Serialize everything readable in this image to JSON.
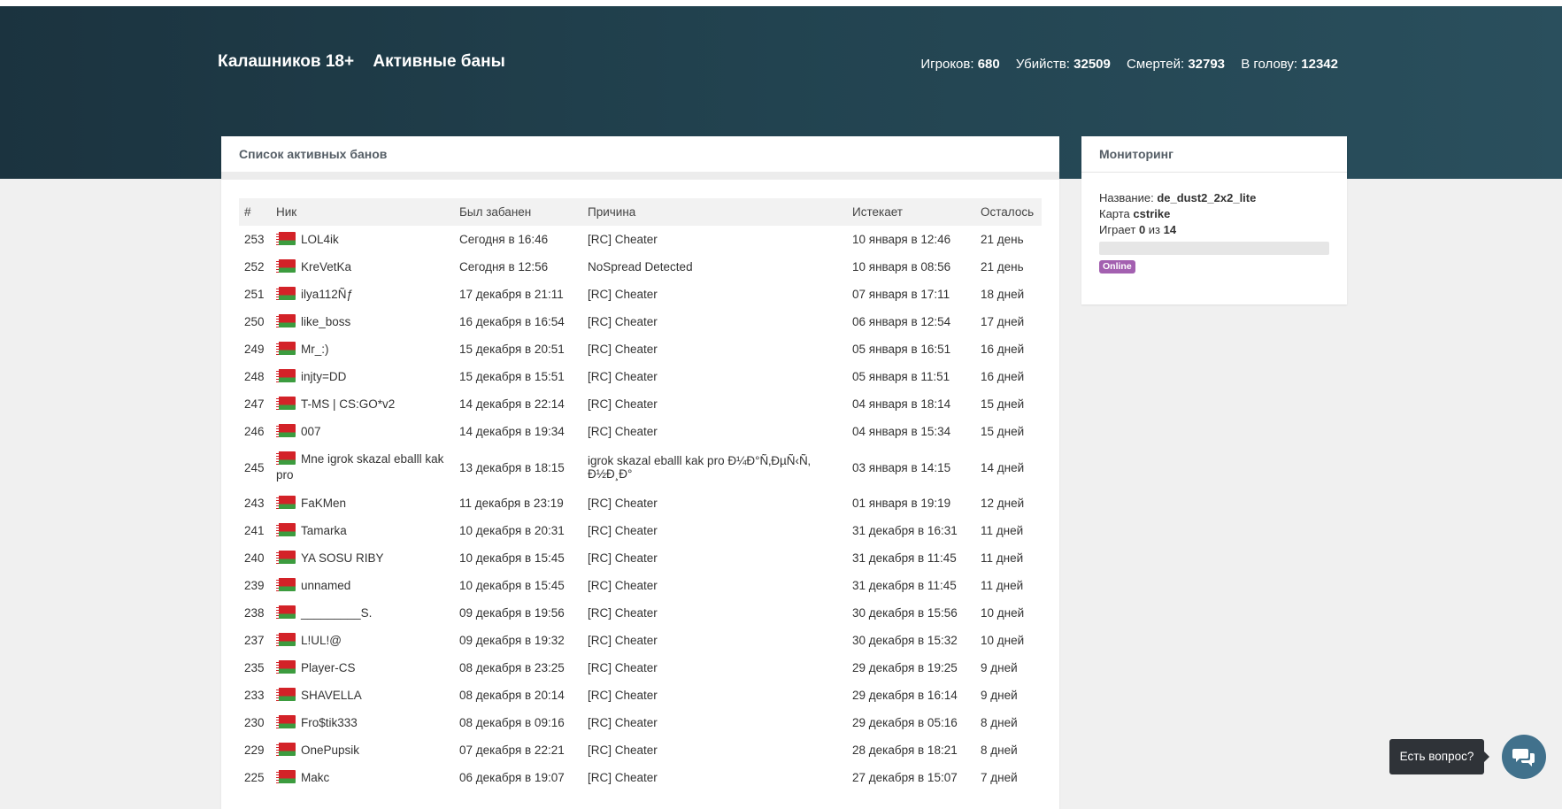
{
  "header": {
    "site_name": "Калашников 18+",
    "section": "Активные баны",
    "stats": [
      {
        "label": "Игроков:",
        "value": "680"
      },
      {
        "label": "Убийств:",
        "value": "32509"
      },
      {
        "label": "Смертей:",
        "value": "32793"
      },
      {
        "label": "В голову:",
        "value": "12342"
      }
    ]
  },
  "bans": {
    "title": "Список активных банов",
    "columns": [
      "#",
      "Ник",
      "Был забанен",
      "Причина",
      "Истекает",
      "Осталось"
    ],
    "rows": [
      {
        "id": "253",
        "nick": "LOL4ik",
        "banned": "Сегодня в 16:46",
        "reason": "[RC] Cheater",
        "expires": "10 января в 12:46",
        "left": "21 день"
      },
      {
        "id": "252",
        "nick": "KreVetKa",
        "banned": "Сегодня в 12:56",
        "reason": "NoSpread Detected",
        "expires": "10 января в 08:56",
        "left": "21 день"
      },
      {
        "id": "251",
        "nick": "ilya112Ñƒ",
        "banned": "17 декабря в 21:11",
        "reason": "[RC] Cheater",
        "expires": "07 января в 17:11",
        "left": "18 дней"
      },
      {
        "id": "250",
        "nick": "like_boss",
        "banned": "16 декабря в 16:54",
        "reason": "[RC] Cheater",
        "expires": "06 января в 12:54",
        "left": "17 дней"
      },
      {
        "id": "249",
        "nick": "Mr_:)",
        "banned": "15 декабря в 20:51",
        "reason": "[RC] Cheater",
        "expires": "05 января в 16:51",
        "left": "16 дней"
      },
      {
        "id": "248",
        "nick": "injty=DD",
        "banned": "15 декабря в 15:51",
        "reason": "[RC] Cheater",
        "expires": "05 января в 11:51",
        "left": "16 дней"
      },
      {
        "id": "247",
        "nick": "T-MS | CS:GO*v2",
        "banned": "14 декабря в 22:14",
        "reason": "[RC] Cheater",
        "expires": "04 января в 18:14",
        "left": "15 дней"
      },
      {
        "id": "246",
        "nick": "007",
        "banned": "14 декабря в 19:34",
        "reason": "[RC] Cheater",
        "expires": "04 января в 15:34",
        "left": "15 дней"
      },
      {
        "id": "245",
        "nick": "Mne igrok skazal eballl kak pro",
        "banned": "13 декабря в 18:15",
        "reason": "igrok skazal eballl kak pro Ð¼Ð°Ñ‚ÐµÑ‹Ñ‚ Ð½Ð¸Ð°",
        "expires": "03 января в 14:15",
        "left": "14 дней"
      },
      {
        "id": "243",
        "nick": "FaKMen",
        "banned": "11 декабря в 23:19",
        "reason": "[RC] Cheater",
        "expires": "01 января в 19:19",
        "left": "12 дней"
      },
      {
        "id": "241",
        "nick": "Tamarka",
        "banned": "10 декабря в 20:31",
        "reason": "[RC] Cheater",
        "expires": "31 декабря в 16:31",
        "left": "11 дней"
      },
      {
        "id": "240",
        "nick": "YA SOSU RIBY",
        "banned": "10 декабря в 15:45",
        "reason": "[RC] Cheater",
        "expires": "31 декабря в 11:45",
        "left": "11 дней"
      },
      {
        "id": "239",
        "nick": "unnamed",
        "banned": "10 декабря в 15:45",
        "reason": "[RC] Cheater",
        "expires": "31 декабря в 11:45",
        "left": "11 дней"
      },
      {
        "id": "238",
        "nick": "_________S.",
        "banned": "09 декабря в 19:56",
        "reason": "[RC] Cheater",
        "expires": "30 декабря в 15:56",
        "left": "10 дней"
      },
      {
        "id": "237",
        "nick": "L!UL!@",
        "banned": "09 декабря в 19:32",
        "reason": "[RC] Cheater",
        "expires": "30 декабря в 15:32",
        "left": "10 дней"
      },
      {
        "id": "235",
        "nick": "Player-CS",
        "banned": "08 декабря в 23:25",
        "reason": "[RC] Cheater",
        "expires": "29 декабря в 19:25",
        "left": "9 дней"
      },
      {
        "id": "233",
        "nick": "SHAVELLA",
        "banned": "08 декабря в 20:14",
        "reason": "[RC] Cheater",
        "expires": "29 декабря в 16:14",
        "left": "9 дней"
      },
      {
        "id": "230",
        "nick": "Fro$tik333",
        "banned": "08 декабря в 09:16",
        "reason": "[RC] Cheater",
        "expires": "29 декабря в 05:16",
        "left": "8 дней"
      },
      {
        "id": "229",
        "nick": "OnePupsik",
        "banned": "07 декабря в 22:21",
        "reason": "[RC] Cheater",
        "expires": "28 декабря в 18:21",
        "left": "8 дней"
      },
      {
        "id": "225",
        "nick": "Makc",
        "banned": "06 декабря в 19:07",
        "reason": "[RC] Cheater",
        "expires": "27 декабря в 15:07",
        "left": "7 дней"
      }
    ]
  },
  "monitoring": {
    "title": "Мониторинг",
    "name_label": "Название:",
    "name_value": "de_dust2_2x2_lite",
    "map_label": "Карта",
    "map_value": "cstrike",
    "playing_label": "Играет",
    "players_current": "0",
    "of_label": "из",
    "players_max": "14",
    "fill_fraction": 0,
    "status": "Online"
  },
  "chat": {
    "label": "Есть вопрос?",
    "icon": "chat-bubbles-icon"
  },
  "colors": {
    "header_bg": "#224350",
    "badge": "#a360b0",
    "chat_button": "#41718c"
  }
}
